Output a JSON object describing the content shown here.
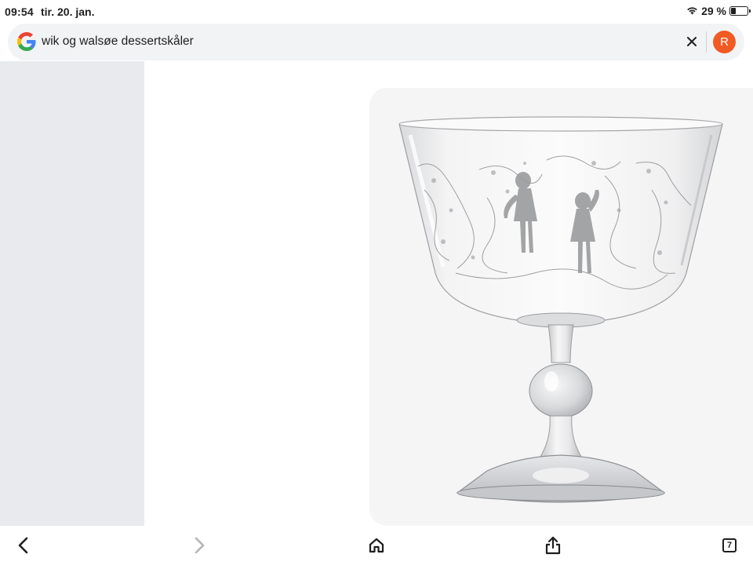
{
  "status_bar": {
    "time": "09:54",
    "date": "tir. 20. jan.",
    "battery_text": "29 %",
    "battery_level": 0.29
  },
  "search": {
    "query": "wik og walsøe dessertskåler",
    "avatar_letter": "R"
  },
  "colors": {
    "avatar_bg": "#f05a24",
    "left_panel_bg": "#e8eaed",
    "search_bg": "#f1f3f4"
  },
  "icons": {
    "search_logo": "google-g-icon",
    "clear": "close-icon",
    "wifi": "wifi-icon",
    "battery": "battery-icon",
    "back": "chevron-left-icon",
    "forward": "chevron-right-icon",
    "home": "home-icon",
    "share": "share-icon",
    "tabs": "tabs-icon"
  },
  "bottom_bar": {
    "tab_count": "7"
  }
}
